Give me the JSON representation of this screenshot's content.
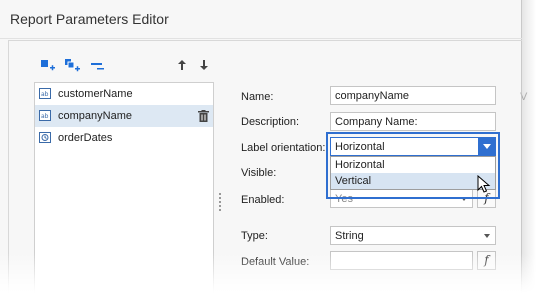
{
  "window": {
    "title": "Report Parameters Editor"
  },
  "toolbar": {
    "icons": [
      "add-parameter-icon",
      "add-group-icon",
      "remove-parameter-icon",
      "move-up-icon",
      "move-down-icon"
    ],
    "accent": "#1e6fd9"
  },
  "parameters": [
    {
      "name": "customerName",
      "icon": "text-parameter-icon",
      "selected": false
    },
    {
      "name": "companyName",
      "icon": "text-parameter-icon",
      "selected": true
    },
    {
      "name": "orderDates",
      "icon": "date-parameter-icon",
      "selected": false
    }
  ],
  "form": {
    "name": {
      "label": "Name:",
      "value": "companyName"
    },
    "description": {
      "label": "Description:",
      "value": "Company Name:"
    },
    "label_orientation": {
      "label": "Label orientation:",
      "value": "Horizontal",
      "options": [
        "Horizontal",
        "Vertical"
      ],
      "highlighted_option": "Vertical"
    },
    "visible": {
      "label": "Visible:"
    },
    "enabled": {
      "label": "Enabled:",
      "value": "Yes"
    },
    "type": {
      "label": "Type:",
      "value": "String"
    },
    "default_value": {
      "label": "Default Value:",
      "value": ""
    },
    "faint_label": "V",
    "fx_label": "f"
  },
  "colors": {
    "highlight_border": "#2f6fd0",
    "selected_row": "#dde8f3",
    "option_highlight": "#d7e4f2"
  }
}
